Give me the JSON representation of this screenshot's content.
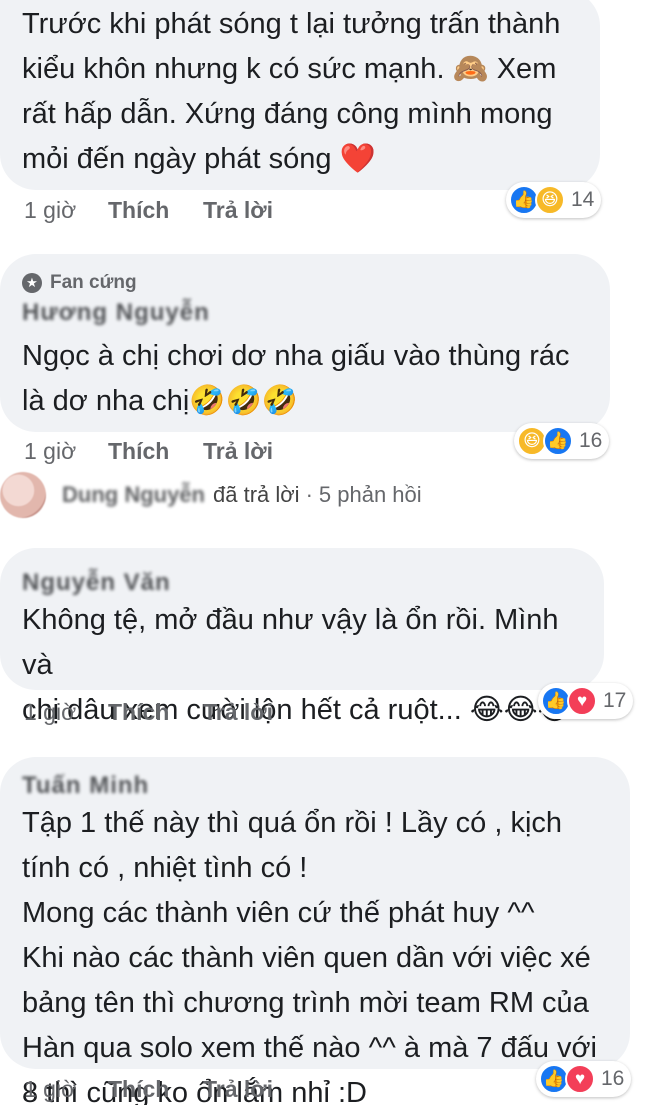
{
  "comments": [
    {
      "author": "",
      "badge": "",
      "text": "Trước khi phát sóng t lại tưởng trấn thành\nkiểu khôn nhưng k có sức mạnh. 🙈 Xem\nrất hấp dẫn. Xứng đáng công mình mong\nmỏi đến ngày phát sóng ❤️",
      "time": "1 giờ",
      "like": "Thích",
      "reply": "Trả lời",
      "reaction_count": "14"
    },
    {
      "author": "Hương Nguyễn",
      "badge": "Fan cứng",
      "text": "Ngọc à chị chơi dơ nha giấu vào thùng rác\nlà dơ nha chị🤣🤣🤣",
      "time": "1 giờ",
      "like": "Thích",
      "reply": "Trả lời",
      "reaction_count": "16"
    },
    {
      "author": "Nguyễn Văn",
      "badge": "",
      "text": "Không tệ, mở đầu như vậy là ổn rồi. Mình và\nchị dâu xem cười lộn hết cả ruột... 😂😂😂",
      "time": "1 giờ",
      "like": "Thích",
      "reply": "Trả lời",
      "reaction_count": "17"
    },
    {
      "author": "Tuấn Minh",
      "badge": "",
      "text": "Tập 1 thế này thì quá ổn rồi ! Lầy có , kịch\ntính có , nhiệt tình có !\nMong các thành viên cứ thế phát huy ^^\nKhi nào các thành viên quen dần với việc xé\nbảng tên thì chương trình mời team RM của\nHàn qua solo xem thế nào ^^ à mà 7 đấu với\n8 thì cũng ko ổn lắm nhỉ :D",
      "time": "1 giờ",
      "like": "Thích",
      "reply": "Trả lời",
      "reaction_count": "16"
    }
  ],
  "reply_summary": {
    "name": "Dung Nguyễn",
    "action": "đã trả lời",
    "separator": "·",
    "count": "5 phản hồi"
  },
  "colors": {
    "bubble": "#f0f2f5",
    "like": "#1877f2",
    "love": "#f33e58",
    "haha": "#f7b928",
    "meta": "#65676b"
  },
  "icons": [
    "like-icon",
    "haha-icon",
    "love-icon",
    "star-badge-icon"
  ]
}
